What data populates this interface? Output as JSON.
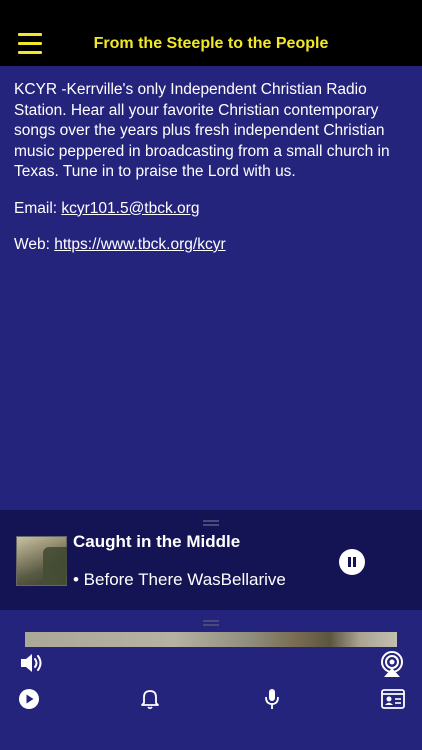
{
  "header": {
    "title": "From the Steeple to the People"
  },
  "about": {
    "description": "KCYR -Kerrville's only Independent Christian Radio Station. Hear all your favorite Christian contemporary songs over the years plus fresh independent Christian music peppered in broadcasting from a small church in Texas. Tune in to praise the Lord with us.",
    "email_label": "Email: ",
    "email": "kcyr101.5@tbck.org",
    "web_label": "Web: ",
    "web": "https://www.tbck.org/kcyr"
  },
  "now_playing": {
    "song": "Caught in the Middle",
    "artist_line": "• Before There WasBellarive",
    "state": "playing"
  },
  "bottom_bar": {
    "icons": [
      "volume-icon",
      "airplay-icon",
      "play-icon",
      "bell-icon",
      "microphone-icon",
      "contact-card-icon"
    ]
  },
  "colors": {
    "accent": "#f2e82a",
    "background": "#25247c",
    "mini_player": "#141454",
    "header": "#000000"
  }
}
